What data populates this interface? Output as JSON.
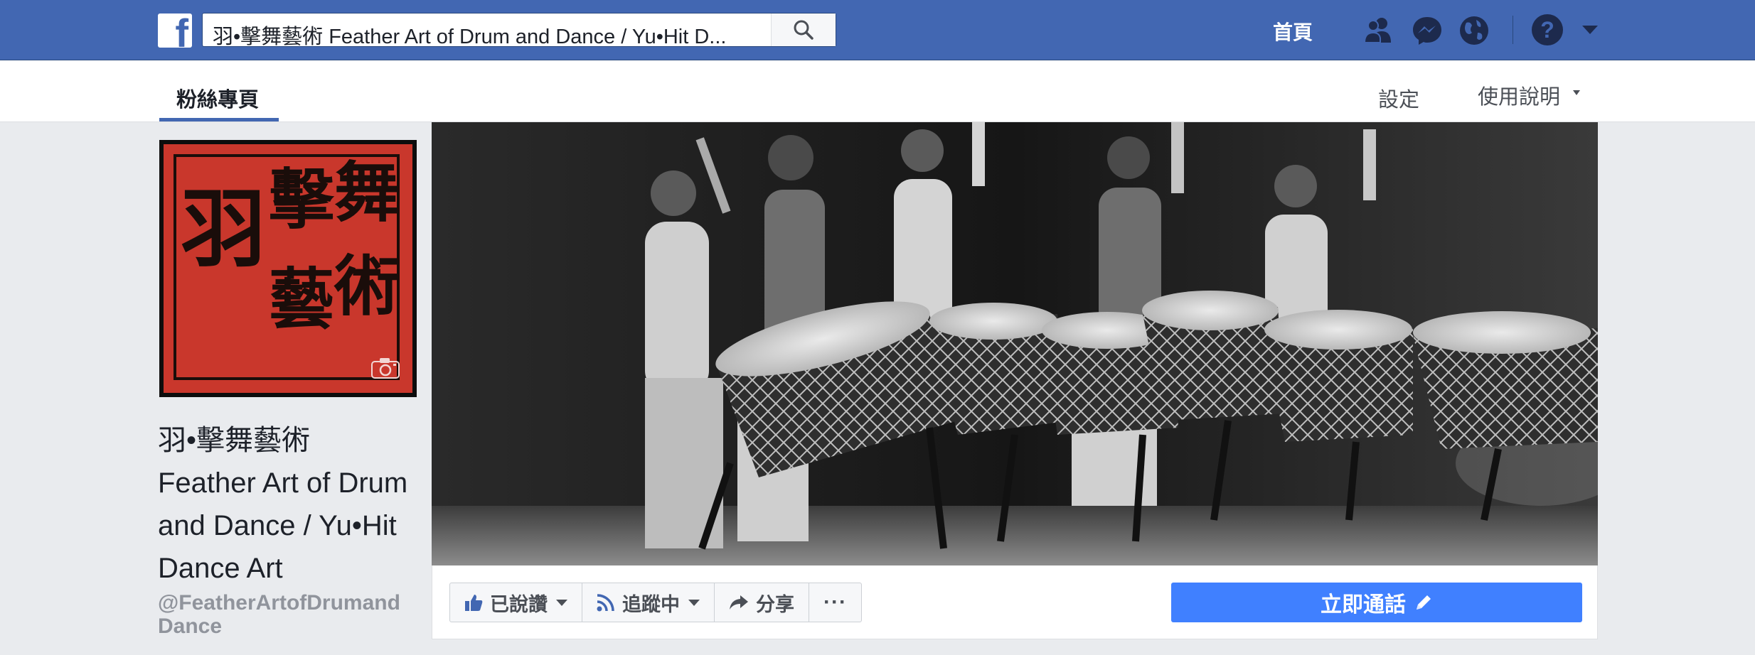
{
  "topbar": {
    "logo": "f",
    "search_value": "羽•擊舞藝術 Feather Art of Drum and Dance / Yu•Hit D...",
    "home_label": "首頁",
    "icons": [
      "friends-icon",
      "messenger-icon",
      "globe-icon",
      "help-icon",
      "chevron-down-icon"
    ],
    "help_glyph": "?"
  },
  "subnav": {
    "tab_fans": "粉絲專頁",
    "settings": "設定",
    "help": "使用說明"
  },
  "profile": {
    "seal_chars": [
      "羽",
      "擊",
      "舞",
      "藝",
      "術"
    ]
  },
  "page": {
    "name": "羽•擊舞藝術 Feather Art of Drum and Dance / Yu•Hit Dance Art",
    "handle": "@FeatherArtofDrumandDance"
  },
  "actions": {
    "like_label": "已說讚",
    "follow_label": "追蹤中",
    "share_label": "分享",
    "more_label": "···",
    "call_label": "立即通話"
  },
  "colors": {
    "brand": "#4267b2",
    "cta": "#4080ff",
    "seal_red": "#c9372c"
  }
}
